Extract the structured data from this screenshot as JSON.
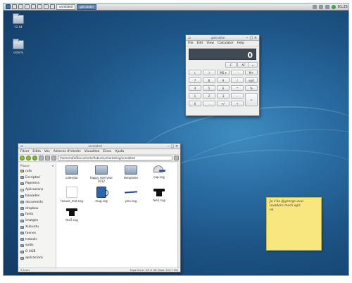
{
  "panel": {
    "tasks": [
      {
        "label": "unrelated",
        "active": false
      },
      {
        "label": "galculator",
        "active": true
      }
    ],
    "clock": "01:25"
  },
  "desktop_icons": [
    {
      "label": "12.04"
    },
    {
      "label": "sistemi"
    }
  ],
  "calculator": {
    "title": "galculator",
    "menu": [
      "File",
      "Edit",
      "View",
      "Calculator",
      "Help"
    ],
    "display": "0",
    "keys": {
      "c": "C",
      "ac": "AC",
      "eq_top": "=",
      "lparen": "(",
      "rparen": ")",
      "ms": "MS ▾",
      "row2_right": "·· ··",
      "mplus": "M+",
      "k7": "7",
      "k8": "8",
      "k9": "9",
      "div": "/",
      "sqrt": "sqrt",
      "k4": "4",
      "k5": "5",
      "k6": "6",
      "mul": "*",
      "pct": "%",
      "k1": "1",
      "k2": "2",
      "k3": "3",
      "minus": "-",
      "eq": "=",
      "k0": "0",
      "dot": ".",
      "sign": "+/-",
      "plus": "+"
    }
  },
  "file_manager": {
    "title": "unrelated",
    "menu": [
      "Fitxer",
      "Edita",
      "Ves",
      "Adreces d'interès",
      "Visualitza",
      "Eines",
      "Ajuda"
    ],
    "path": "/home/rafa/Documents/Xubuntu/marketing/unrelated",
    "places_header": "Places",
    "places": [
      {
        "label": "rafa",
        "icon": "home-icon"
      },
      {
        "label": "Escriptori",
        "icon": "folder-icon"
      },
      {
        "label": "Paperera",
        "icon": "trash-icon"
      },
      {
        "label": "Aplicacions",
        "icon": "applications-icon"
      },
      {
        "label": "baixades",
        "icon": "folder-icon"
      },
      {
        "label": "documents",
        "icon": "folder-icon"
      },
      {
        "label": "dropbox",
        "icon": "folder-icon"
      },
      {
        "label": "fonts",
        "icon": "folder-icon"
      },
      {
        "label": "imatges",
        "icon": "folder-icon"
      },
      {
        "label": "Xubuntu",
        "icon": "folder-icon"
      },
      {
        "label": "faenes",
        "icon": "folder-icon"
      },
      {
        "label": "treballs",
        "icon": "folder-icon"
      },
      {
        "label": "sodis",
        "icon": "folder-icon"
      },
      {
        "label": "O 4GB",
        "icon": "drive-icon"
      },
      {
        "label": "aplicacions",
        "icon": "folder-icon"
      }
    ],
    "files": [
      {
        "name": "calendar",
        "icon": "folder-icon"
      },
      {
        "name": "happy new year\n2012",
        "icon": "folder-icon"
      },
      {
        "name": "templates",
        "icon": "folder-icon"
      },
      {
        "name": "cap.svg",
        "icon": "cap-icon"
      },
      {
        "name": "mouse_mat.svg",
        "icon": "document-icon"
      },
      {
        "name": "mug.svg",
        "icon": "mug-icon"
      },
      {
        "name": "pen.svg",
        "icon": "pen-icon"
      },
      {
        "name": "tee1.svg",
        "icon": "tshirt-icon"
      },
      {
        "name": "tee2.svg",
        "icon": "tshirt-icon"
      }
    ],
    "status_left": "9 items",
    "status_right": "Espai lliure: 101,9 GB (Total: 105,7 GB)"
  },
  "sticky_note": {
    "text": "Ja s'ha @george avui\nlevadore msch agri\nok"
  }
}
